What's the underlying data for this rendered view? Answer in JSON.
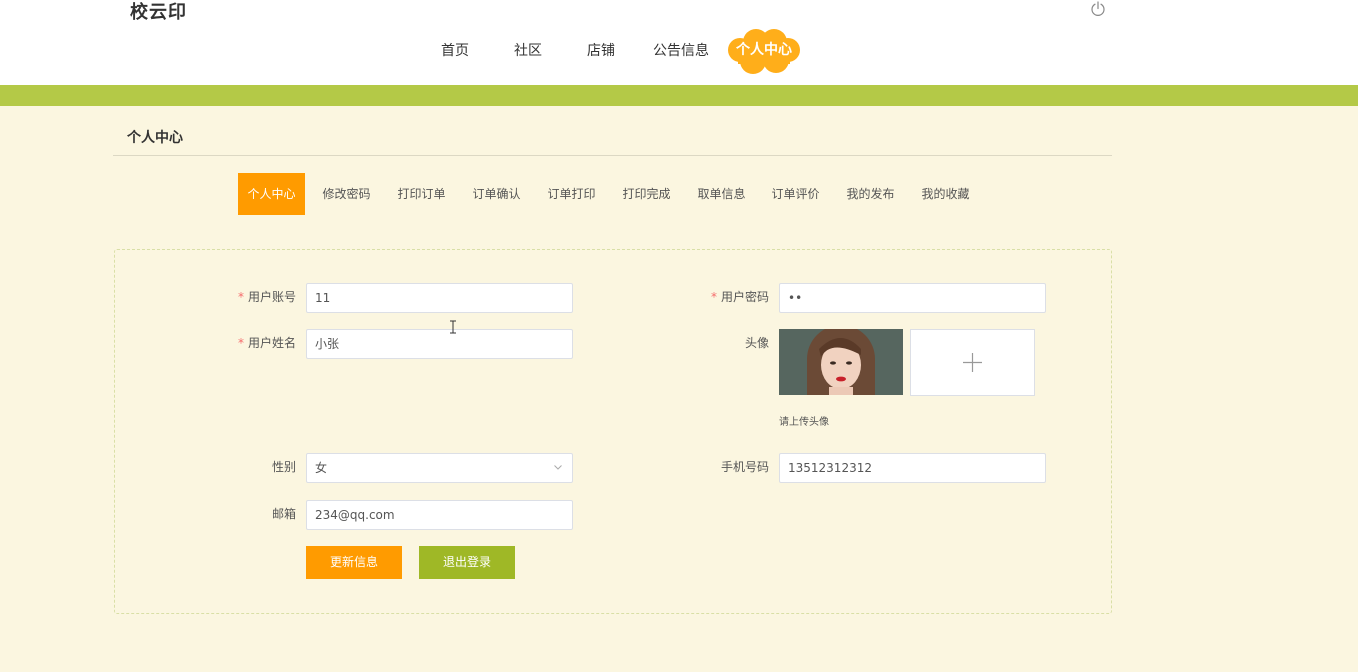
{
  "app": {
    "logo": "校云印"
  },
  "nav": {
    "items": [
      "首页",
      "社区",
      "店铺",
      "公告信息"
    ],
    "active": "个人中心"
  },
  "section": {
    "title": "个人中心"
  },
  "tabs": {
    "items": [
      "个人中心",
      "修改密码",
      "打印订单",
      "订单确认",
      "订单打印",
      "打印完成",
      "取单信息",
      "订单评价",
      "我的发布",
      "我的收藏"
    ],
    "active_index": 0
  },
  "form": {
    "required_mark": "*",
    "account": {
      "label": "用户账号",
      "value": "11"
    },
    "password": {
      "label": "用户密码",
      "value": "••"
    },
    "name": {
      "label": "用户姓名",
      "value": "小张"
    },
    "avatar": {
      "label": "头像",
      "tip": "请上传头像"
    },
    "gender": {
      "label": "性别",
      "value": "女"
    },
    "phone": {
      "label": "手机号码",
      "value": "13512312312"
    },
    "email": {
      "label": "邮箱",
      "value": "234@qq.com"
    }
  },
  "buttons": {
    "update": "更新信息",
    "logout": "退出登录"
  },
  "colors": {
    "accent_orange": "#ff9b00",
    "accent_green": "#b4c947",
    "logout_green": "#9fb826",
    "page_background": "#fbf6e0"
  },
  "icons": {
    "power": "power-icon",
    "select_arrow": "chevron-down-icon",
    "upload": "plus-icon"
  }
}
